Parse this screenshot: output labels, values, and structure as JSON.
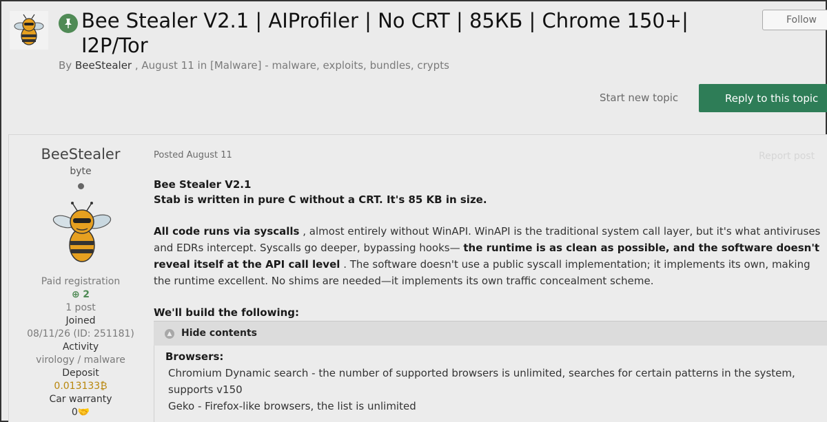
{
  "topic": {
    "title": "Bee Stealer V2.1 | AIProfiler | No CRT | 85КБ | Chrome 150+| I2P/Tor",
    "follow_label": "Follow",
    "byline_prefix": "By",
    "author": "BeeStealer",
    "byline_rest": ", August 11 in [Malware] - malware, exploits, bundles, crypts",
    "start_new_topic": "Start new topic",
    "reply_label": "Reply to this topic",
    "pin_icon": "pin-icon",
    "accent_color": "#2e7d57"
  },
  "author_panel": {
    "name": "BeeStealer",
    "rank": "byte",
    "group": "Paid registration",
    "reputation": "2",
    "posts": "1 post",
    "joined_label": "Joined",
    "joined_value": "08/11/26 (ID: 251181)",
    "activity_label": "Activity",
    "activity_value": "virology / malware",
    "deposit_label": "Deposit",
    "deposit_value": "0.013133₿",
    "warranty_label": "Car warranty",
    "warranty_value": "0"
  },
  "post": {
    "posted": "Posted August 11",
    "report": "Report post",
    "heading1": "Bee Stealer V2.1",
    "heading2": "Stab is written in pure C without a CRT. It's 85 KB in size.",
    "p1_bold1": "All code runs via syscalls",
    "p1_text1": ", almost entirely without WinAPI. WinAPI is the traditional system call layer, but it's what antiviruses and EDRs intercept. Syscalls go deeper, bypassing hooks—",
    "p1_bold2": "the runtime is as clean as possible, and the software doesn't reveal itself at the API call level",
    "p1_text2": ". The software doesn't use a public syscall implementation; it implements its own, making the runtime excellent. No shims are needed—it implements its own traffic concealment scheme.",
    "build_heading": "We'll build the following:",
    "hide_label": "Hide contents",
    "browsers_heading": "Browsers:",
    "browser_line1": "Chromium Dynamic search - the number of supported browsers is unlimited, searches for certain patterns in the system, supports v150",
    "browser_line2": "Geko - Firefox-like browsers, the list is unlimited"
  }
}
